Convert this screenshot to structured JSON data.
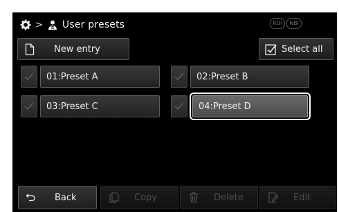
{
  "header": {
    "separator": ">",
    "title": "User presets",
    "badges": [
      "RDI",
      "NBI"
    ]
  },
  "toolbar": {
    "new_entry_label": "New entry",
    "select_all_label": "Select all"
  },
  "presets": [
    {
      "label": "01:Preset A",
      "selected": false
    },
    {
      "label": "02:Preset B",
      "selected": false
    },
    {
      "label": "03:Preset C",
      "selected": false
    },
    {
      "label": "04:Preset D",
      "selected": true
    }
  ],
  "footer": {
    "back_label": "Back",
    "copy_label": "Copy",
    "delete_label": "Delete",
    "edit_label": "Edit"
  },
  "icons": {
    "gear": "gear-icon",
    "user": "user-icon",
    "new_entry": "document-icon",
    "select_all": "checkbox-icon",
    "back": "back-arrow-icon",
    "copy": "copy-icon",
    "delete": "trash-icon",
    "edit": "edit-icon"
  },
  "colors": {
    "background": "#000000",
    "text": "#f0f0f0",
    "disabled_text": "#4d4d4d",
    "selection_outline": "#ffffff"
  }
}
